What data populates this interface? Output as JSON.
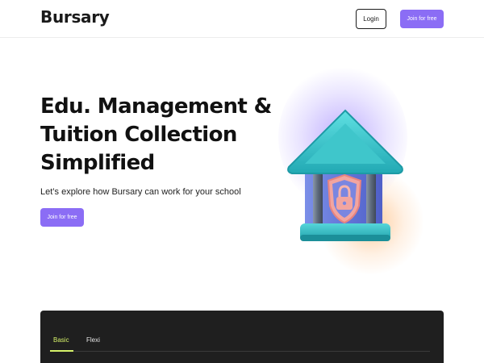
{
  "header": {
    "logo": "Bursary",
    "login_label": "Login",
    "join_label": "Join for free"
  },
  "hero": {
    "title_lines": [
      "Edu. Management &",
      "Tuition Collection",
      "Simplified"
    ],
    "subtitle": "Let’s explore how Bursary can work for your school",
    "cta_label": "Join for free",
    "illustration_icon": "bank-lock-icon"
  },
  "panel": {
    "tabs": [
      {
        "label": "Basic",
        "active": true
      },
      {
        "label": "Flexi",
        "active": false
      }
    ]
  },
  "colors": {
    "accent": "#8b6df5",
    "panel_bg": "#1f1f1f",
    "tab_active": "#d6f26a",
    "building_teal": "#2ec4c9",
    "building_purple": "#6a7de0"
  }
}
